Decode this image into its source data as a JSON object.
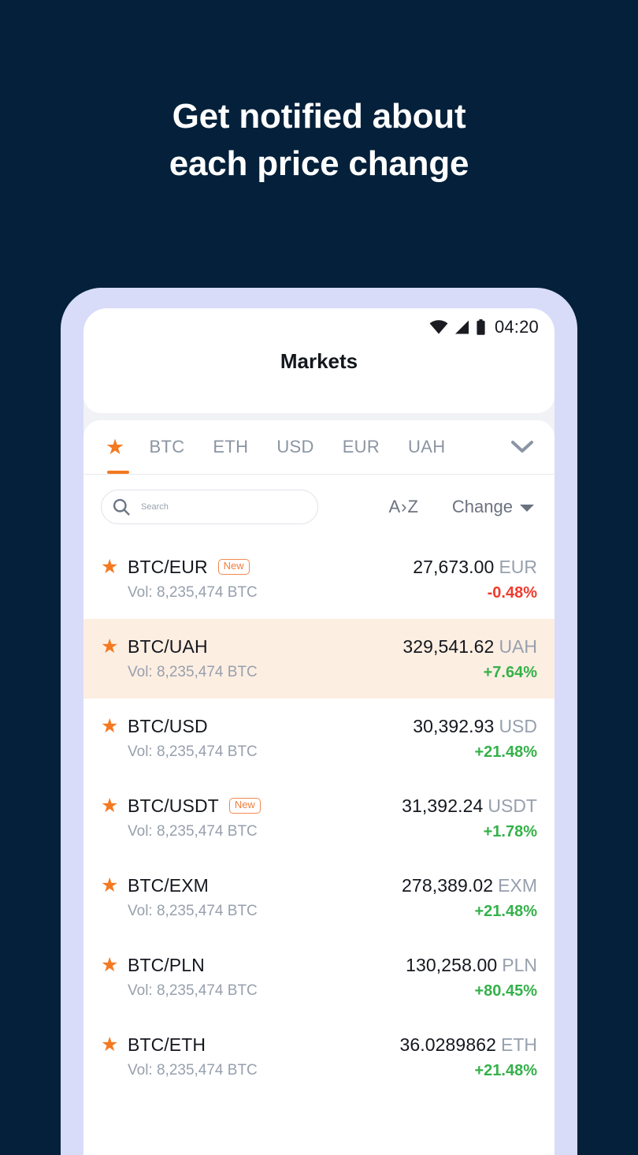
{
  "headline": {
    "line1": "Get notified about",
    "line2": "each price change"
  },
  "colors": {
    "background": "#04203a",
    "phone_bezel": "#d8dcf8",
    "accent_orange": "#f47920",
    "highlight_row": "#fdeee2",
    "up_green": "#35b14a",
    "down_red": "#ef3b2d"
  },
  "statusbar": {
    "time": "04:20",
    "wifi_icon": "wifi-icon",
    "signal_icon": "cellular-signal-icon",
    "battery_icon": "battery-icon"
  },
  "appbar": {
    "title": "Markets"
  },
  "tabs": {
    "items": [
      {
        "label": "★",
        "name": "favorites",
        "active": true,
        "is_icon": true
      },
      {
        "label": "BTC",
        "name": "btc",
        "active": false,
        "is_icon": false
      },
      {
        "label": "ETH",
        "name": "eth",
        "active": false,
        "is_icon": false
      },
      {
        "label": "USD",
        "name": "usd",
        "active": false,
        "is_icon": false
      },
      {
        "label": "EUR",
        "name": "eur",
        "active": false,
        "is_icon": false
      },
      {
        "label": "UAH",
        "name": "uah",
        "active": false,
        "is_icon": false
      }
    ],
    "expand_icon": "chevron-down-icon"
  },
  "search": {
    "placeholder": "Search",
    "value": "",
    "icon": "search-icon"
  },
  "sort": {
    "alpha_label": "A›Z",
    "change_label": "Change",
    "change_caret": "caret-down-icon"
  },
  "markets": {
    "vol_prefix": "Vol:",
    "rows": [
      {
        "pair": "BTC/EUR",
        "badge": "New",
        "volume": "Vol: 8,235,474 BTC",
        "price": "27,673.00",
        "currency": "EUR",
        "change": "-0.48%",
        "direction": "down",
        "highlight": false,
        "favorite": true
      },
      {
        "pair": "BTC/UAH",
        "badge": "",
        "volume": "Vol: 8,235,474 BTC",
        "price": "329,541.62",
        "currency": "UAH",
        "change": "+7.64%",
        "direction": "up",
        "highlight": true,
        "favorite": true
      },
      {
        "pair": "BTC/USD",
        "badge": "",
        "volume": "Vol: 8,235,474 BTC",
        "price": "30,392.93",
        "currency": "USD",
        "change": "+21.48%",
        "direction": "up",
        "highlight": false,
        "favorite": true
      },
      {
        "pair": "BTC/USDT",
        "badge": "New",
        "volume": "Vol: 8,235,474 BTC",
        "price": "31,392.24",
        "currency": "USDT",
        "change": "+1.78%",
        "direction": "up",
        "highlight": false,
        "favorite": true
      },
      {
        "pair": "BTC/EXM",
        "badge": "",
        "volume": "Vol: 8,235,474 BTC",
        "price": "278,389.02",
        "currency": "EXM",
        "change": "+21.48%",
        "direction": "up",
        "highlight": false,
        "favorite": true
      },
      {
        "pair": "BTC/PLN",
        "badge": "",
        "volume": "Vol: 8,235,474 BTC",
        "price": "130,258.00",
        "currency": "PLN",
        "change": "+80.45%",
        "direction": "up",
        "highlight": false,
        "favorite": true
      },
      {
        "pair": "BTC/ETH",
        "badge": "",
        "volume": "Vol: 8,235,474 BTC",
        "price": "36.0289862",
        "currency": "ETH",
        "change": "+21.48%",
        "direction": "up",
        "highlight": false,
        "favorite": true
      }
    ]
  }
}
